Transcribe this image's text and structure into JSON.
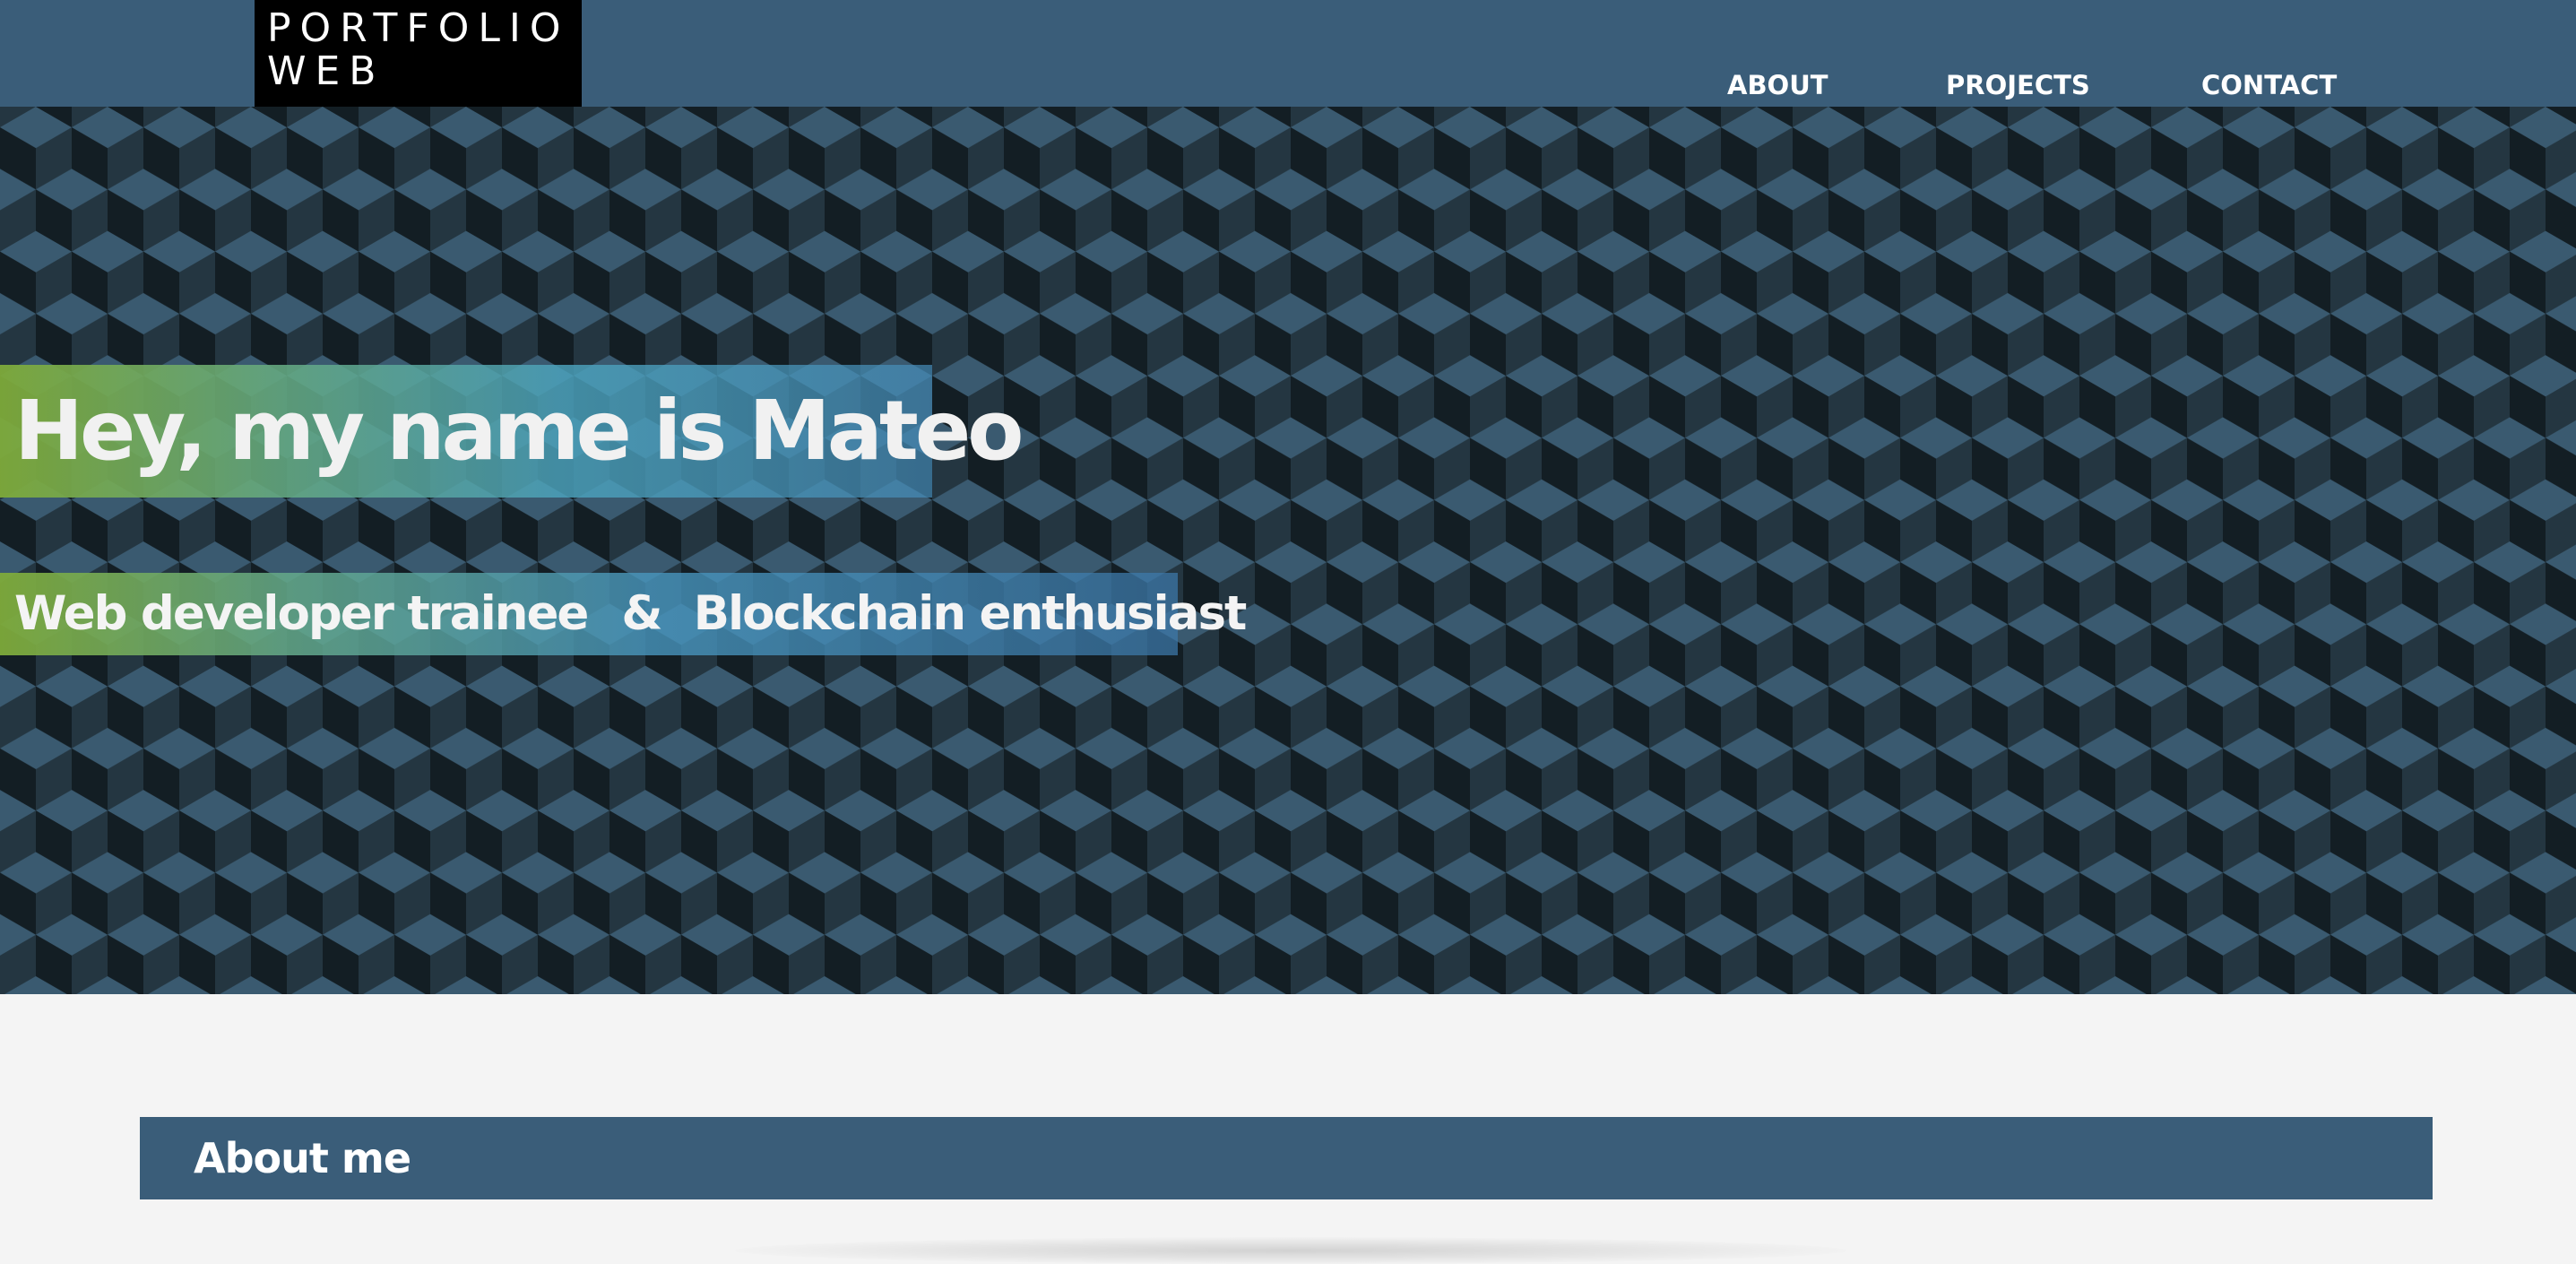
{
  "logo": {
    "line1": "PORTFOLIO",
    "line2": "WEB"
  },
  "nav": {
    "items": [
      {
        "label": "ABOUT"
      },
      {
        "label": "PROJECTS"
      },
      {
        "label": "CONTACT"
      }
    ]
  },
  "hero": {
    "title": "Hey, my name is Mateo",
    "subtitle": {
      "part1": "Web developer trainee",
      "separator": "&",
      "part2": "Blockchain enthusiast"
    }
  },
  "about": {
    "title": "About me"
  },
  "colors": {
    "header": "#3a5d79",
    "logo_bg": "#000000",
    "page_bg": "#f4f4f4",
    "cube_light": "#3a5a70",
    "cube_mid": "#243641",
    "cube_dark": "#131e24",
    "gradient_start": "#7eaa3a",
    "gradient_end": "#468cb9"
  }
}
